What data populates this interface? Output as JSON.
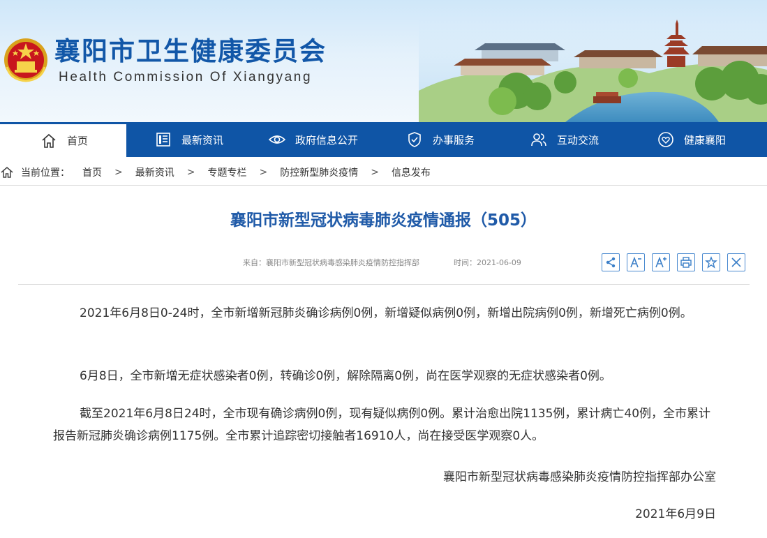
{
  "header": {
    "title": "襄阳市卫生健康委员会",
    "subtitle": "Health Commission Of Xiangyang",
    "brand_color": "#0f55a6"
  },
  "nav": {
    "items": [
      {
        "label": "首页",
        "icon": "home-icon",
        "active": true
      },
      {
        "label": "最新资讯",
        "icon": "news-icon"
      },
      {
        "label": "政府信息公开",
        "icon": "eye-icon"
      },
      {
        "label": "办事服务",
        "icon": "shield-icon"
      },
      {
        "label": "互动交流",
        "icon": "users-icon"
      },
      {
        "label": "健康襄阳",
        "icon": "heart-icon"
      }
    ]
  },
  "breadcrumb": {
    "prefix": "当前位置：",
    "items": [
      "首页",
      "最新资讯",
      "专题专栏",
      "防控新型肺炎疫情",
      "信息发布"
    ],
    "separator": ">"
  },
  "article": {
    "title": "襄阳市新型冠状病毒肺炎疫情通报（505）",
    "source": "来自：襄阳市新型冠状病毒感染肺炎疫情防控指挥部",
    "time": "时间：2021-06-09",
    "tools": [
      "share-icon",
      "font-decrease-icon",
      "font-increase-icon",
      "print-icon",
      "favorite-icon",
      "close-icon"
    ],
    "paragraphs": [
      "2021年6月8日0-24时，全市新增新冠肺炎确诊病例0例，新增疑似病例0例，新增出院病例0例，新增死亡病例0例。",
      "6月8日，全市新增无症状感染者0例，转确诊0例，解除隔离0例，尚在医学观察的无症状感染者0例。",
      "截至2021年6月8日24时，全市现有确诊病例0例，现有疑似病例0例。累计治愈出院1135例，累计病亡40例，全市累计报告新冠肺炎确诊病例1175例。全市累计追踪密切接触者16910人，尚在接受医学观察0人。"
    ],
    "signature": "襄阳市新型冠状病毒感染肺炎疫情防控指挥部办公室",
    "date": "2021年6月9日"
  }
}
